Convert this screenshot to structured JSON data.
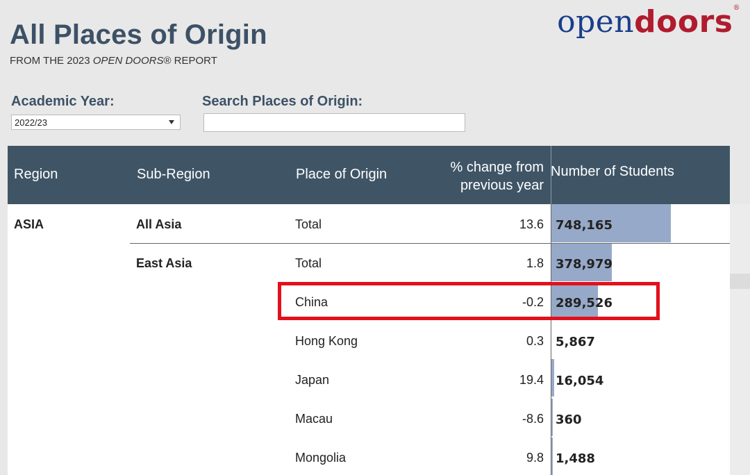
{
  "header": {
    "title": "All Places of Origin",
    "subtitle_prefix": "FROM THE 2023 ",
    "subtitle_italic": "OPEN DOORS",
    "subtitle_suffix": "® REPORT",
    "logo_open": "open",
    "logo_doors": "doors",
    "logo_mark": "®"
  },
  "filters": {
    "year_label": "Academic Year:",
    "year_value": "2022/23",
    "search_label": "Search Places of Origin:",
    "search_value": ""
  },
  "table": {
    "columns": {
      "region": "Region",
      "subregion": "Sub-Region",
      "place": "Place of Origin",
      "change_line1": "% change from",
      "change_line2": "previous year",
      "students": "Number of Students"
    },
    "rows": [
      {
        "region": "ASIA",
        "subregion": "All Asia",
        "place": "Total",
        "change": "13.6",
        "students": "748,165",
        "value": 748165
      },
      {
        "region": "",
        "subregion": "East Asia",
        "place": "Total",
        "change": "1.8",
        "students": "378,979",
        "value": 378979
      },
      {
        "region": "",
        "subregion": "",
        "place": "China",
        "change": "-0.2",
        "students": "289,526",
        "value": 289526
      },
      {
        "region": "",
        "subregion": "",
        "place": "Hong Kong",
        "change": "0.3",
        "students": "5,867",
        "value": 5867
      },
      {
        "region": "",
        "subregion": "",
        "place": "Japan",
        "change": "19.4",
        "students": "16,054",
        "value": 16054
      },
      {
        "region": "",
        "subregion": "",
        "place": "Macau",
        "change": "-8.6",
        "students": "360",
        "value": 360
      },
      {
        "region": "",
        "subregion": "",
        "place": "Mongolia",
        "change": "9.8",
        "students": "1,488",
        "value": 1488
      }
    ]
  },
  "colors": {
    "header_bg": "#3f5566",
    "title": "#3d5166",
    "bar": "#97a9c8",
    "highlight": "#e3101b",
    "logo_open": "#1a3e8c",
    "logo_doors": "#b01c2e"
  }
}
